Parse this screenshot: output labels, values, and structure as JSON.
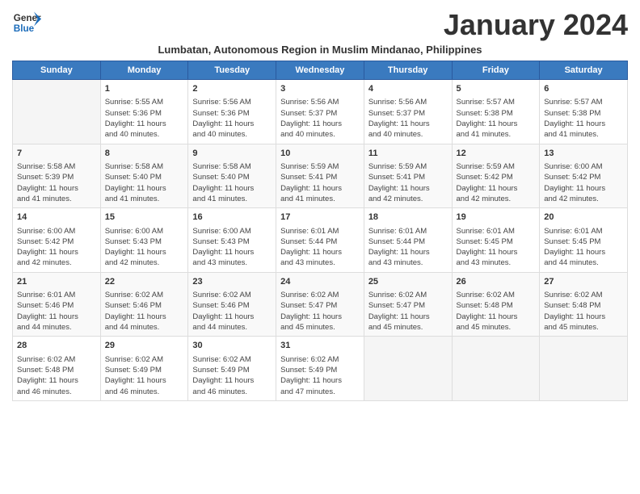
{
  "header": {
    "logo_line1": "General",
    "logo_line2": "Blue",
    "month_title": "January 2024",
    "subtitle": "Lumbatan, Autonomous Region in Muslim Mindanao, Philippines"
  },
  "days_of_week": [
    "Sunday",
    "Monday",
    "Tuesday",
    "Wednesday",
    "Thursday",
    "Friday",
    "Saturday"
  ],
  "weeks": [
    [
      {
        "day": "",
        "info": ""
      },
      {
        "day": "1",
        "info": "Sunrise: 5:55 AM\nSunset: 5:36 PM\nDaylight: 11 hours\nand 40 minutes."
      },
      {
        "day": "2",
        "info": "Sunrise: 5:56 AM\nSunset: 5:36 PM\nDaylight: 11 hours\nand 40 minutes."
      },
      {
        "day": "3",
        "info": "Sunrise: 5:56 AM\nSunset: 5:37 PM\nDaylight: 11 hours\nand 40 minutes."
      },
      {
        "day": "4",
        "info": "Sunrise: 5:56 AM\nSunset: 5:37 PM\nDaylight: 11 hours\nand 40 minutes."
      },
      {
        "day": "5",
        "info": "Sunrise: 5:57 AM\nSunset: 5:38 PM\nDaylight: 11 hours\nand 41 minutes."
      },
      {
        "day": "6",
        "info": "Sunrise: 5:57 AM\nSunset: 5:38 PM\nDaylight: 11 hours\nand 41 minutes."
      }
    ],
    [
      {
        "day": "7",
        "info": "Sunrise: 5:58 AM\nSunset: 5:39 PM\nDaylight: 11 hours\nand 41 minutes."
      },
      {
        "day": "8",
        "info": "Sunrise: 5:58 AM\nSunset: 5:40 PM\nDaylight: 11 hours\nand 41 minutes."
      },
      {
        "day": "9",
        "info": "Sunrise: 5:58 AM\nSunset: 5:40 PM\nDaylight: 11 hours\nand 41 minutes."
      },
      {
        "day": "10",
        "info": "Sunrise: 5:59 AM\nSunset: 5:41 PM\nDaylight: 11 hours\nand 41 minutes."
      },
      {
        "day": "11",
        "info": "Sunrise: 5:59 AM\nSunset: 5:41 PM\nDaylight: 11 hours\nand 42 minutes."
      },
      {
        "day": "12",
        "info": "Sunrise: 5:59 AM\nSunset: 5:42 PM\nDaylight: 11 hours\nand 42 minutes."
      },
      {
        "day": "13",
        "info": "Sunrise: 6:00 AM\nSunset: 5:42 PM\nDaylight: 11 hours\nand 42 minutes."
      }
    ],
    [
      {
        "day": "14",
        "info": "Sunrise: 6:00 AM\nSunset: 5:42 PM\nDaylight: 11 hours\nand 42 minutes."
      },
      {
        "day": "15",
        "info": "Sunrise: 6:00 AM\nSunset: 5:43 PM\nDaylight: 11 hours\nand 42 minutes."
      },
      {
        "day": "16",
        "info": "Sunrise: 6:00 AM\nSunset: 5:43 PM\nDaylight: 11 hours\nand 43 minutes."
      },
      {
        "day": "17",
        "info": "Sunrise: 6:01 AM\nSunset: 5:44 PM\nDaylight: 11 hours\nand 43 minutes."
      },
      {
        "day": "18",
        "info": "Sunrise: 6:01 AM\nSunset: 5:44 PM\nDaylight: 11 hours\nand 43 minutes."
      },
      {
        "day": "19",
        "info": "Sunrise: 6:01 AM\nSunset: 5:45 PM\nDaylight: 11 hours\nand 43 minutes."
      },
      {
        "day": "20",
        "info": "Sunrise: 6:01 AM\nSunset: 5:45 PM\nDaylight: 11 hours\nand 44 minutes."
      }
    ],
    [
      {
        "day": "21",
        "info": "Sunrise: 6:01 AM\nSunset: 5:46 PM\nDaylight: 11 hours\nand 44 minutes."
      },
      {
        "day": "22",
        "info": "Sunrise: 6:02 AM\nSunset: 5:46 PM\nDaylight: 11 hours\nand 44 minutes."
      },
      {
        "day": "23",
        "info": "Sunrise: 6:02 AM\nSunset: 5:46 PM\nDaylight: 11 hours\nand 44 minutes."
      },
      {
        "day": "24",
        "info": "Sunrise: 6:02 AM\nSunset: 5:47 PM\nDaylight: 11 hours\nand 45 minutes."
      },
      {
        "day": "25",
        "info": "Sunrise: 6:02 AM\nSunset: 5:47 PM\nDaylight: 11 hours\nand 45 minutes."
      },
      {
        "day": "26",
        "info": "Sunrise: 6:02 AM\nSunset: 5:48 PM\nDaylight: 11 hours\nand 45 minutes."
      },
      {
        "day": "27",
        "info": "Sunrise: 6:02 AM\nSunset: 5:48 PM\nDaylight: 11 hours\nand 45 minutes."
      }
    ],
    [
      {
        "day": "28",
        "info": "Sunrise: 6:02 AM\nSunset: 5:48 PM\nDaylight: 11 hours\nand 46 minutes."
      },
      {
        "day": "29",
        "info": "Sunrise: 6:02 AM\nSunset: 5:49 PM\nDaylight: 11 hours\nand 46 minutes."
      },
      {
        "day": "30",
        "info": "Sunrise: 6:02 AM\nSunset: 5:49 PM\nDaylight: 11 hours\nand 46 minutes."
      },
      {
        "day": "31",
        "info": "Sunrise: 6:02 AM\nSunset: 5:49 PM\nDaylight: 11 hours\nand 47 minutes."
      },
      {
        "day": "",
        "info": ""
      },
      {
        "day": "",
        "info": ""
      },
      {
        "day": "",
        "info": ""
      }
    ]
  ]
}
